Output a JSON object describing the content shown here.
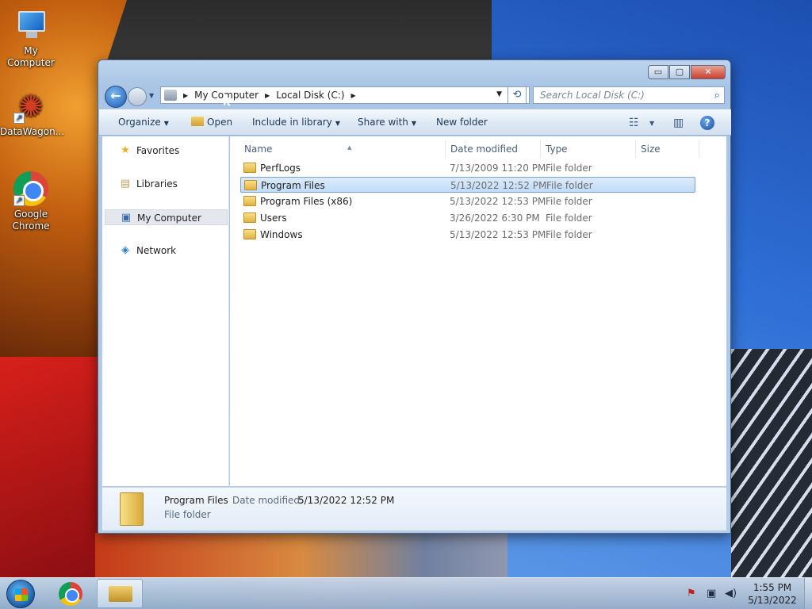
{
  "desktop": {
    "icons": [
      {
        "label": "My Computer"
      },
      {
        "label": "DataWagon..."
      },
      {
        "label": "Google Chrome"
      }
    ]
  },
  "window": {
    "caption": {
      "minimize": "▭",
      "maximize": "▢",
      "close": "✕"
    },
    "address": {
      "crumbs": [
        "My Computer",
        "Local Disk (C:)"
      ]
    },
    "search": {
      "placeholder": "Search Local Disk (C:)"
    },
    "toolbar": {
      "organize": "Organize",
      "open": "Open",
      "include_in_library": "Include in library",
      "share_with": "Share with",
      "new_folder": "New folder",
      "help": "?"
    },
    "nav_pane": {
      "items": [
        {
          "label": "Favorites",
          "icon": "star-icon"
        },
        {
          "label": "Libraries",
          "icon": "libraries-icon"
        },
        {
          "label": "My Computer",
          "icon": "computer-icon",
          "selected": true
        },
        {
          "label": "Network",
          "icon": "network-icon"
        }
      ]
    },
    "columns": [
      "Name",
      "Date modified",
      "Type",
      "Size"
    ],
    "files": [
      {
        "name": "PerfLogs",
        "date": "7/13/2009 11:20 PM",
        "type": "File folder"
      },
      {
        "name": "Program Files",
        "date": "5/13/2022 12:52 PM",
        "type": "File folder",
        "selected": true
      },
      {
        "name": "Program Files (x86)",
        "date": "5/13/2022 12:53 PM",
        "type": "File folder"
      },
      {
        "name": "Users",
        "date": "3/26/2022 6:30 PM",
        "type": "File folder"
      },
      {
        "name": "Windows",
        "date": "5/13/2022 12:53 PM",
        "type": "File folder"
      }
    ],
    "details": {
      "name": "Program Files",
      "date_label": "Date modified:",
      "date": "5/13/2022 12:52 PM",
      "type": "File folder"
    }
  },
  "taskbar": {
    "clock_time": "1:55 PM",
    "clock_date": "5/13/2022"
  }
}
